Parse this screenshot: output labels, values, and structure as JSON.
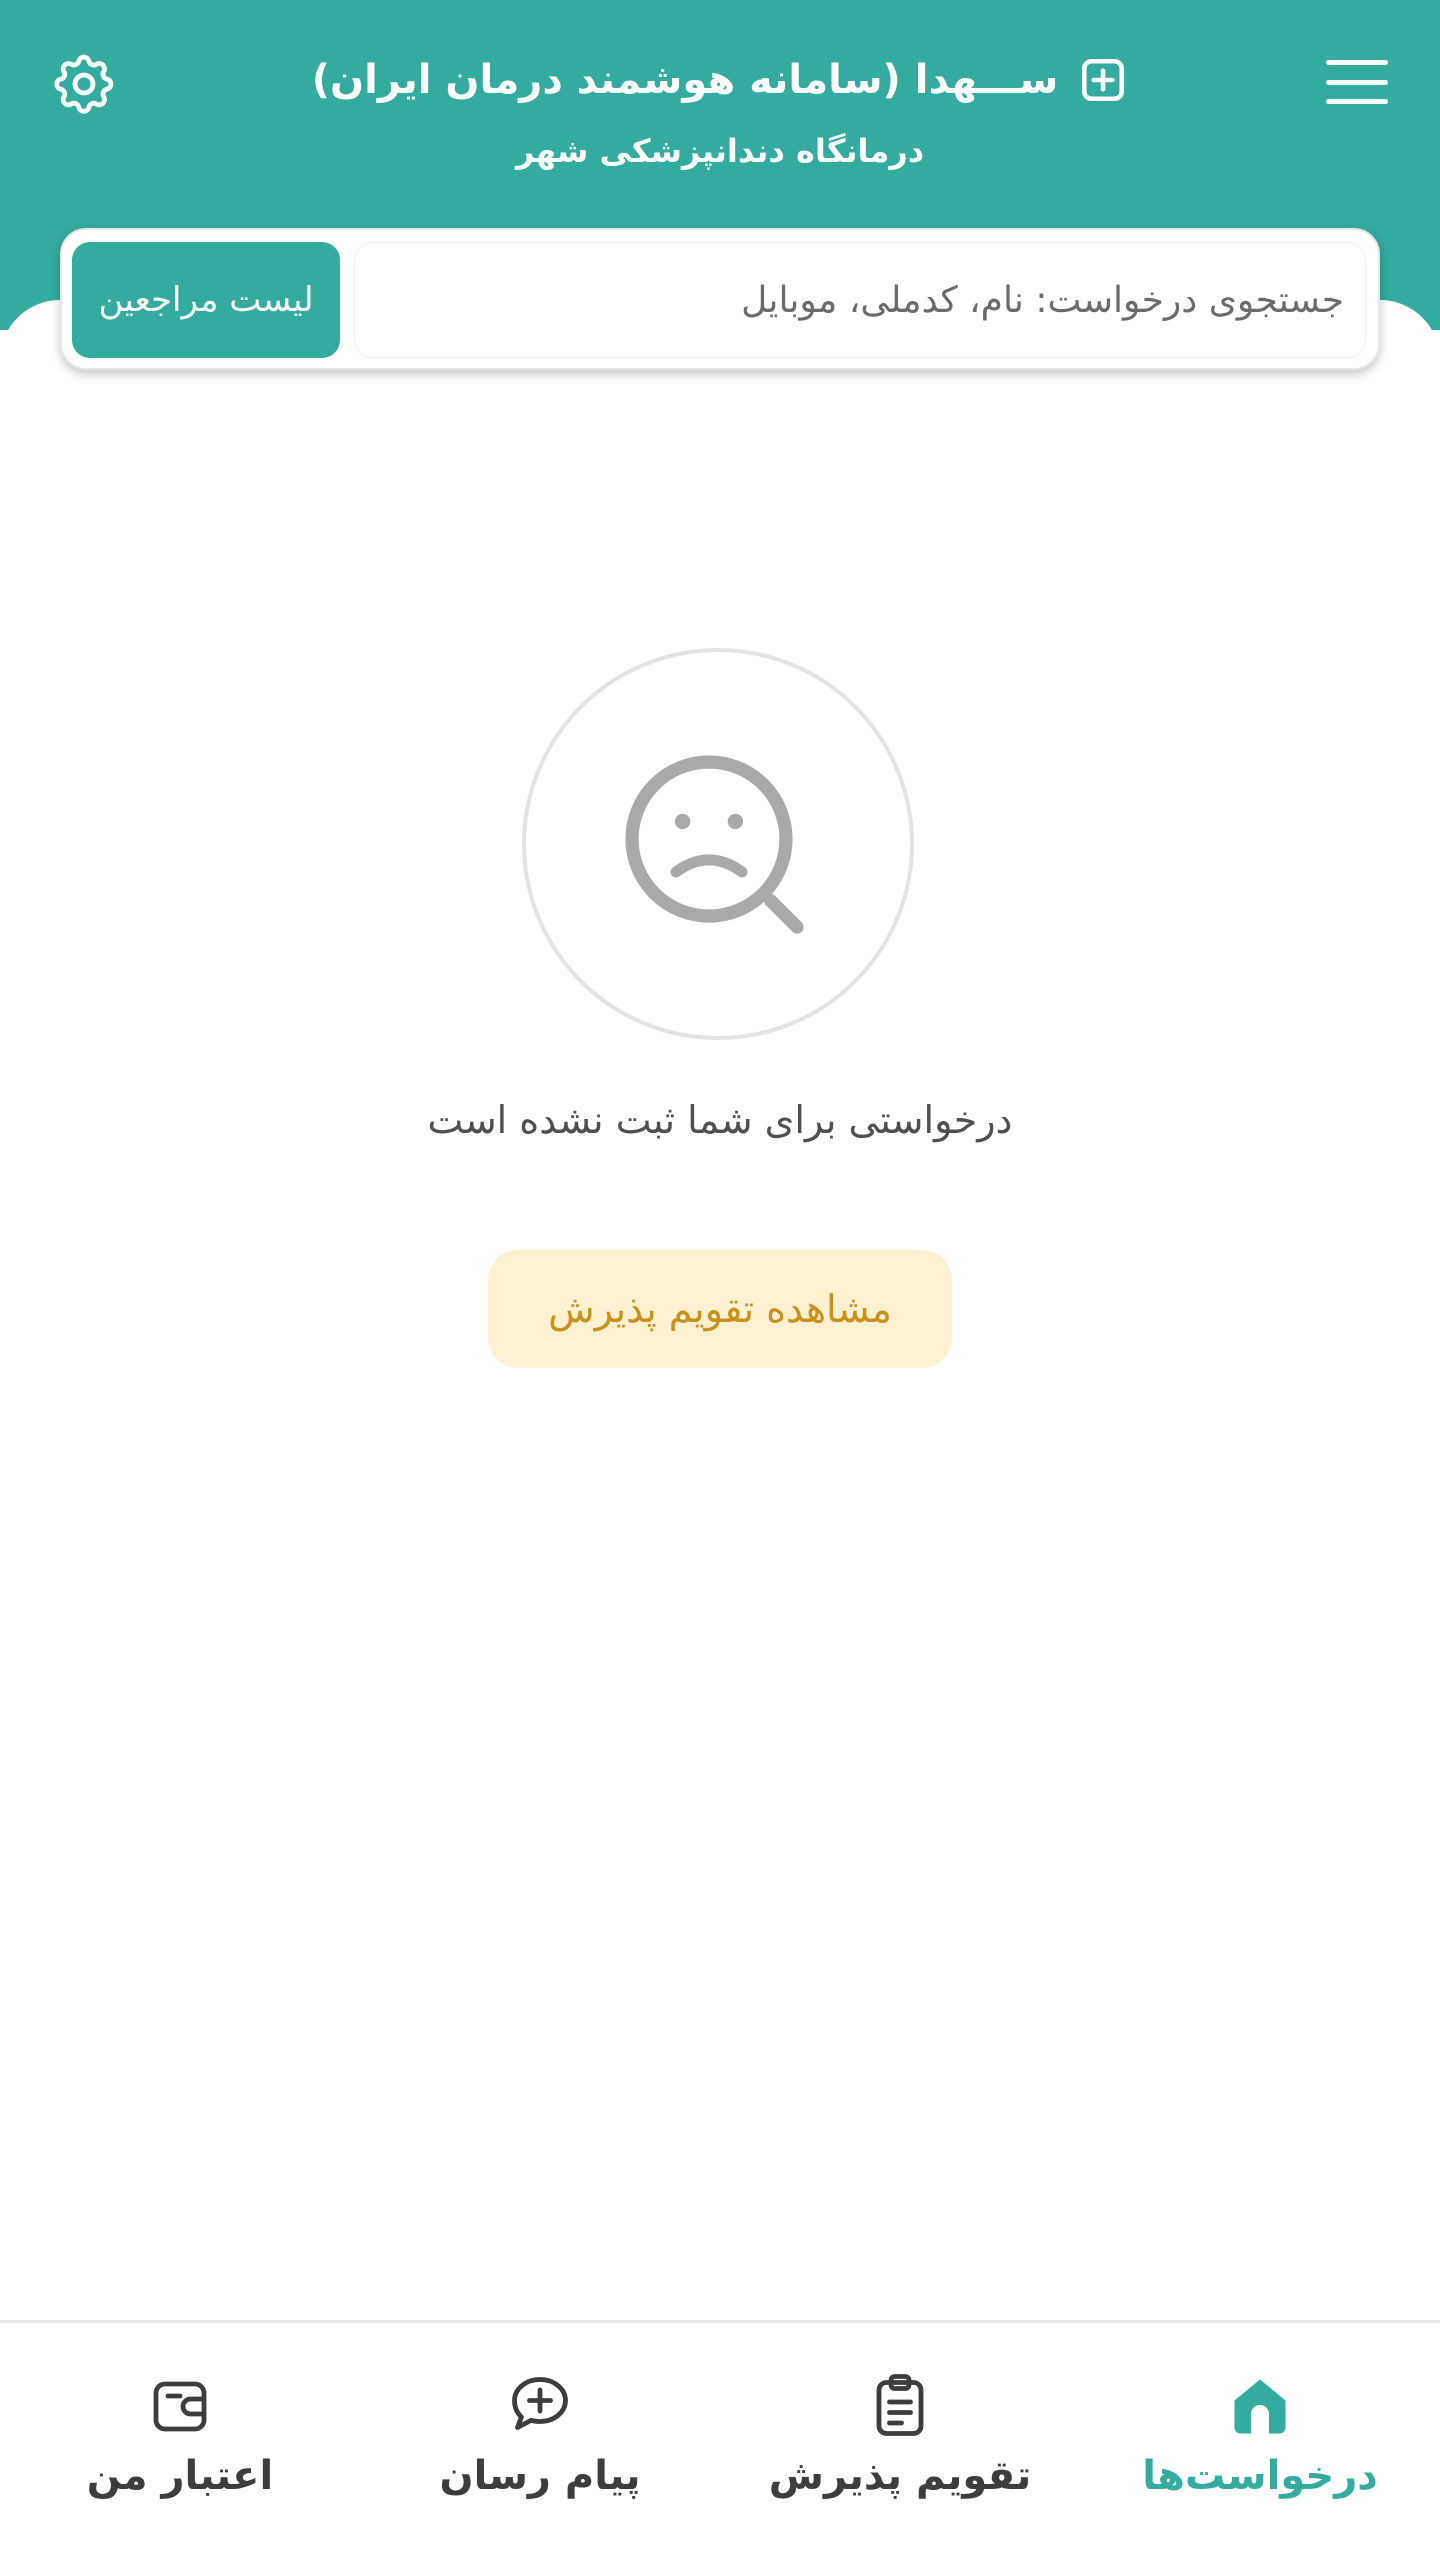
{
  "header": {
    "title": "ســـهدا (سامانه هوشمند درمان ایران)",
    "subtitle": "درمانگاه دندانپزشکی شهر",
    "menu_icon": "hamburger-menu-icon",
    "settings_icon": "gear-icon",
    "title_icon": "plus-box-icon"
  },
  "search": {
    "placeholder": "جستجوی درخواست: نام، کدملی، موبایل",
    "value": "",
    "clients_button": "لیست مراجعین"
  },
  "empty_state": {
    "icon": "sad-search-icon",
    "message": "درخواستی برای شما ثبت نشده است",
    "action_label": "مشاهده تقویم پذیرش"
  },
  "bottom_nav": [
    {
      "label": "درخواست‌ها",
      "icon": "home-icon",
      "active": true
    },
    {
      "label": "تقویم پذیرش",
      "icon": "clipboard-icon",
      "active": false
    },
    {
      "label": "پیام رسان",
      "icon": "chat-plus-icon",
      "active": false
    },
    {
      "label": "اعتبار من",
      "icon": "wallet-icon",
      "active": false
    }
  ],
  "colors": {
    "primary": "#33ab9f",
    "accent_bg": "#fdf1d2",
    "accent_text": "#c9901b",
    "icon_gray": "#a9a9a9"
  }
}
